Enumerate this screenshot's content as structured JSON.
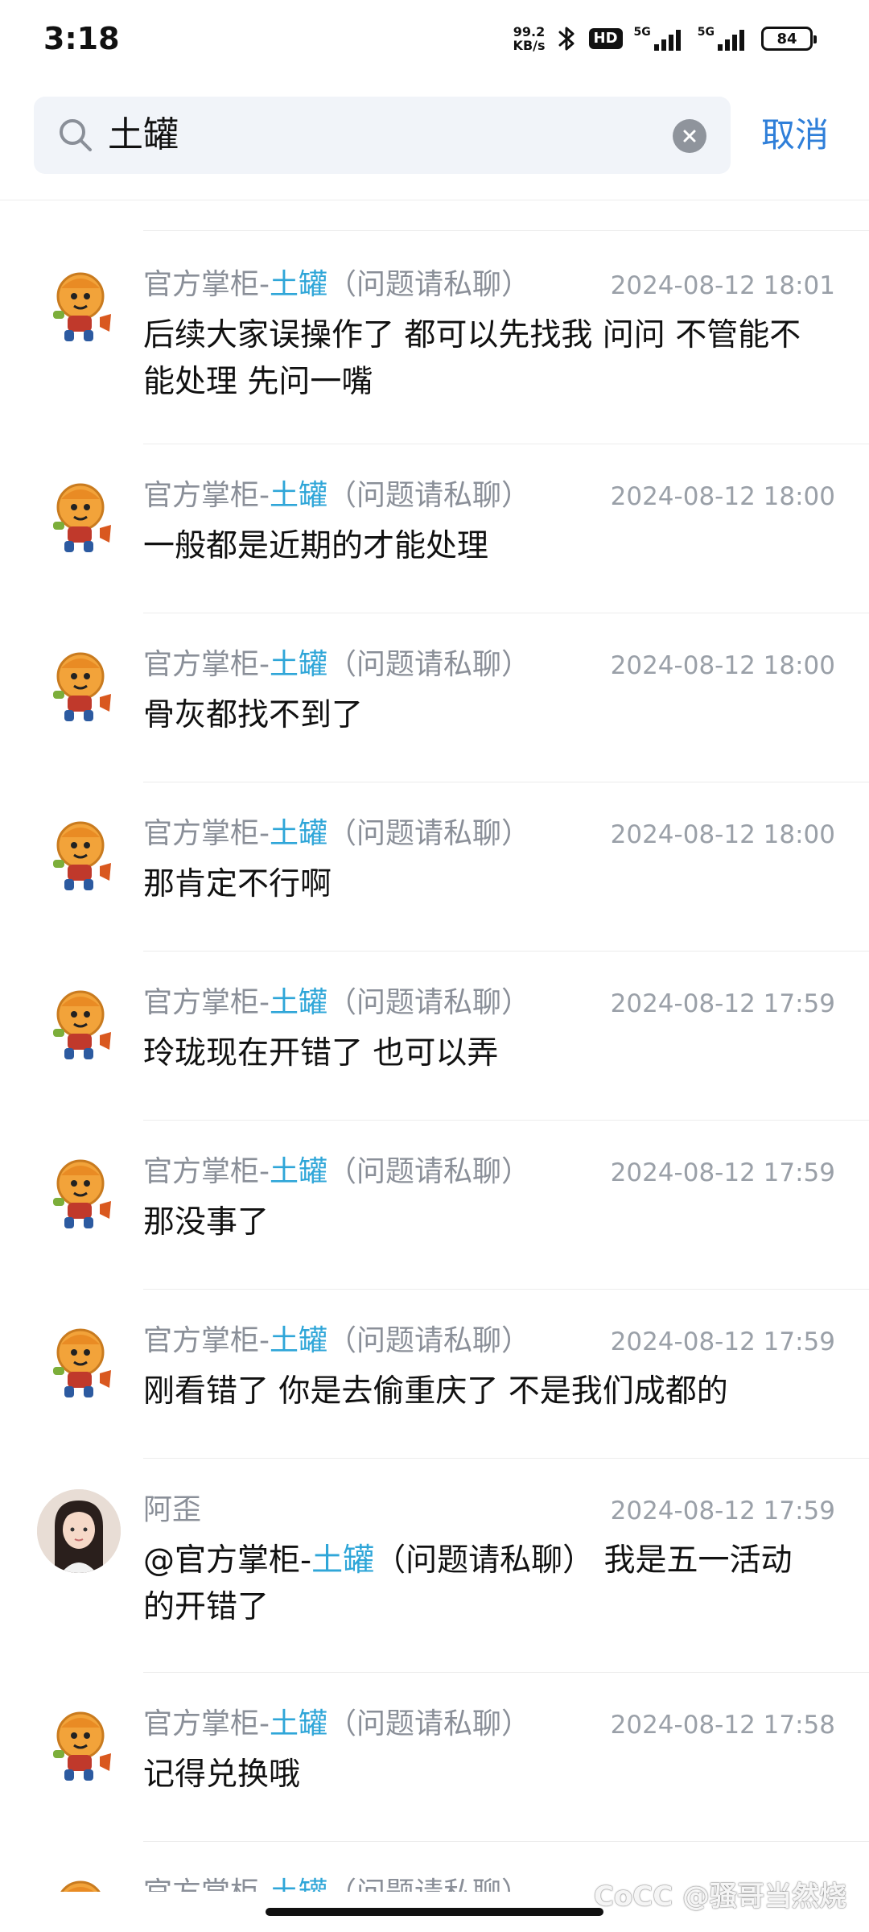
{
  "status_bar": {
    "time": "3:18",
    "net_speed_value": "99.2",
    "net_speed_unit": "KB/s",
    "hd_label": "HD",
    "signal1_label": "5G",
    "signal2_label": "5G",
    "battery": "84"
  },
  "search": {
    "query": "土罐",
    "cancel_label": "取消"
  },
  "messages": [
    {
      "sender_prefix": "官方掌柜-",
      "sender_highlight": "土罐",
      "sender_suffix": "（问题请私聊）",
      "time": "2024-08-12 18:01",
      "text": "后续大家误操作了 都可以先找我 问问  不管能不能处理  先问一嘴",
      "avatar": "mascot-avatar"
    },
    {
      "sender_prefix": "官方掌柜-",
      "sender_highlight": "土罐",
      "sender_suffix": "（问题请私聊）",
      "time": "2024-08-12 18:00",
      "text": "一般都是近期的才能处理",
      "avatar": "mascot-avatar"
    },
    {
      "sender_prefix": "官方掌柜-",
      "sender_highlight": "土罐",
      "sender_suffix": "（问题请私聊）",
      "time": "2024-08-12 18:00",
      "text": "骨灰都找不到了",
      "avatar": "mascot-avatar"
    },
    {
      "sender_prefix": "官方掌柜-",
      "sender_highlight": "土罐",
      "sender_suffix": "（问题请私聊）",
      "time": "2024-08-12 18:00",
      "text": "那肯定不行啊",
      "avatar": "mascot-avatar"
    },
    {
      "sender_prefix": "官方掌柜-",
      "sender_highlight": "土罐",
      "sender_suffix": "（问题请私聊）",
      "time": "2024-08-12 17:59",
      "text": "玲珑现在开错了  也可以弄",
      "avatar": "mascot-avatar"
    },
    {
      "sender_prefix": "官方掌柜-",
      "sender_highlight": "土罐",
      "sender_suffix": "（问题请私聊）",
      "time": "2024-08-12 17:59",
      "text": "那没事了",
      "avatar": "mascot-avatar"
    },
    {
      "sender_prefix": "官方掌柜-",
      "sender_highlight": "土罐",
      "sender_suffix": "（问题请私聊）",
      "time": "2024-08-12 17:59",
      "text": "刚看错了  你是去偷重庆了   不是我们成都的",
      "avatar": "mascot-avatar"
    },
    {
      "sender_name": "阿歪",
      "time": "2024-08-12 17:59",
      "mention_prefix": "@官方掌柜-",
      "mention_highlight": "土罐",
      "mention_suffix": "（问题请私聊）",
      "text_rest": "  我是五一活动的开错了",
      "avatar": "girl-avatar"
    },
    {
      "sender_prefix": "官方掌柜-",
      "sender_highlight": "土罐",
      "sender_suffix": "（问题请私聊）",
      "time": "2024-08-12 17:58",
      "text": "记得兑换哦",
      "avatar": "mascot-avatar"
    },
    {
      "sender_prefix": "官方掌柜-",
      "sender_highlight": "土罐",
      "sender_suffix": "（问题请私聊）",
      "time": "",
      "text": "",
      "avatar": "mascot-avatar"
    }
  ],
  "watermark": "CoCC @骚哥当然烧",
  "colors": {
    "accent_blue": "#2f7fd9",
    "highlight": "#2fa6d8",
    "meta_gray": "#8a8f98",
    "search_bg": "#f1f4f9"
  }
}
